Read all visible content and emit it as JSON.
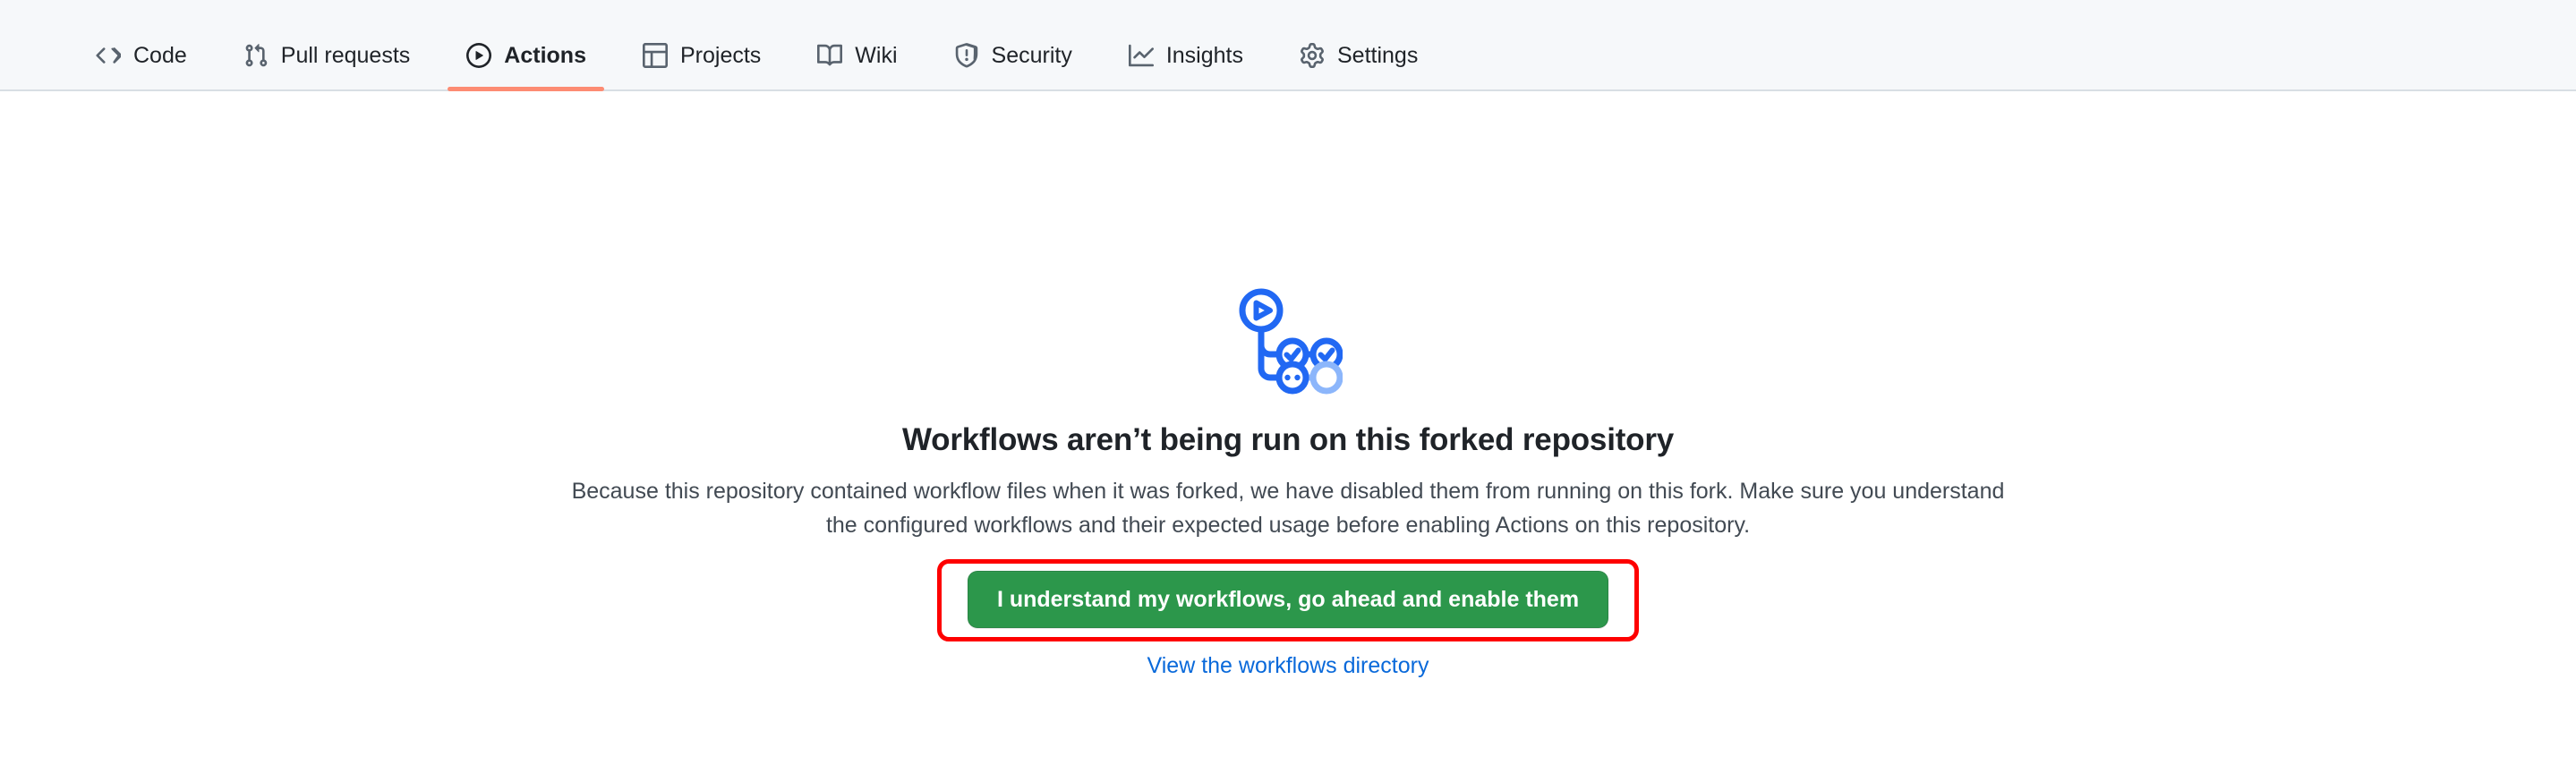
{
  "colors": {
    "nav_background": "#f6f8fa",
    "nav_border": "#d8dee4",
    "active_tab_underline": "#fd8c73",
    "heading_text": "#1f2328",
    "body_text": "#424a53",
    "button_green": "#2c974b",
    "highlight_red": "#fe0000",
    "link_blue": "#0969da",
    "logo_blue": "#2168f3",
    "logo_blue_faded": "#8cb6fb"
  },
  "repo_nav": {
    "items": [
      {
        "label": "Code",
        "icon": "code-icon",
        "active": false
      },
      {
        "label": "Pull requests",
        "icon": "git-pull-request-icon",
        "active": false
      },
      {
        "label": "Actions",
        "icon": "play-circle-icon",
        "active": true
      },
      {
        "label": "Projects",
        "icon": "table-icon",
        "active": false
      },
      {
        "label": "Wiki",
        "icon": "book-icon",
        "active": false
      },
      {
        "label": "Security",
        "icon": "shield-alert-icon",
        "active": false
      },
      {
        "label": "Insights",
        "icon": "graph-icon",
        "active": false
      },
      {
        "label": "Settings",
        "icon": "gear-icon",
        "active": false
      }
    ]
  },
  "blankslate": {
    "logo_icon": "github-actions-logo",
    "heading": "Workflows aren’t being run on this forked repository",
    "body": "Because this repository contained workflow files when it was forked, we have disabled them from running on this fork. Make sure you understand the configured workflows and their expected usage before enabling Actions on this repository.",
    "primary_button": "I understand my workflows, go ahead and enable them",
    "secondary_link": "View the workflows directory"
  }
}
